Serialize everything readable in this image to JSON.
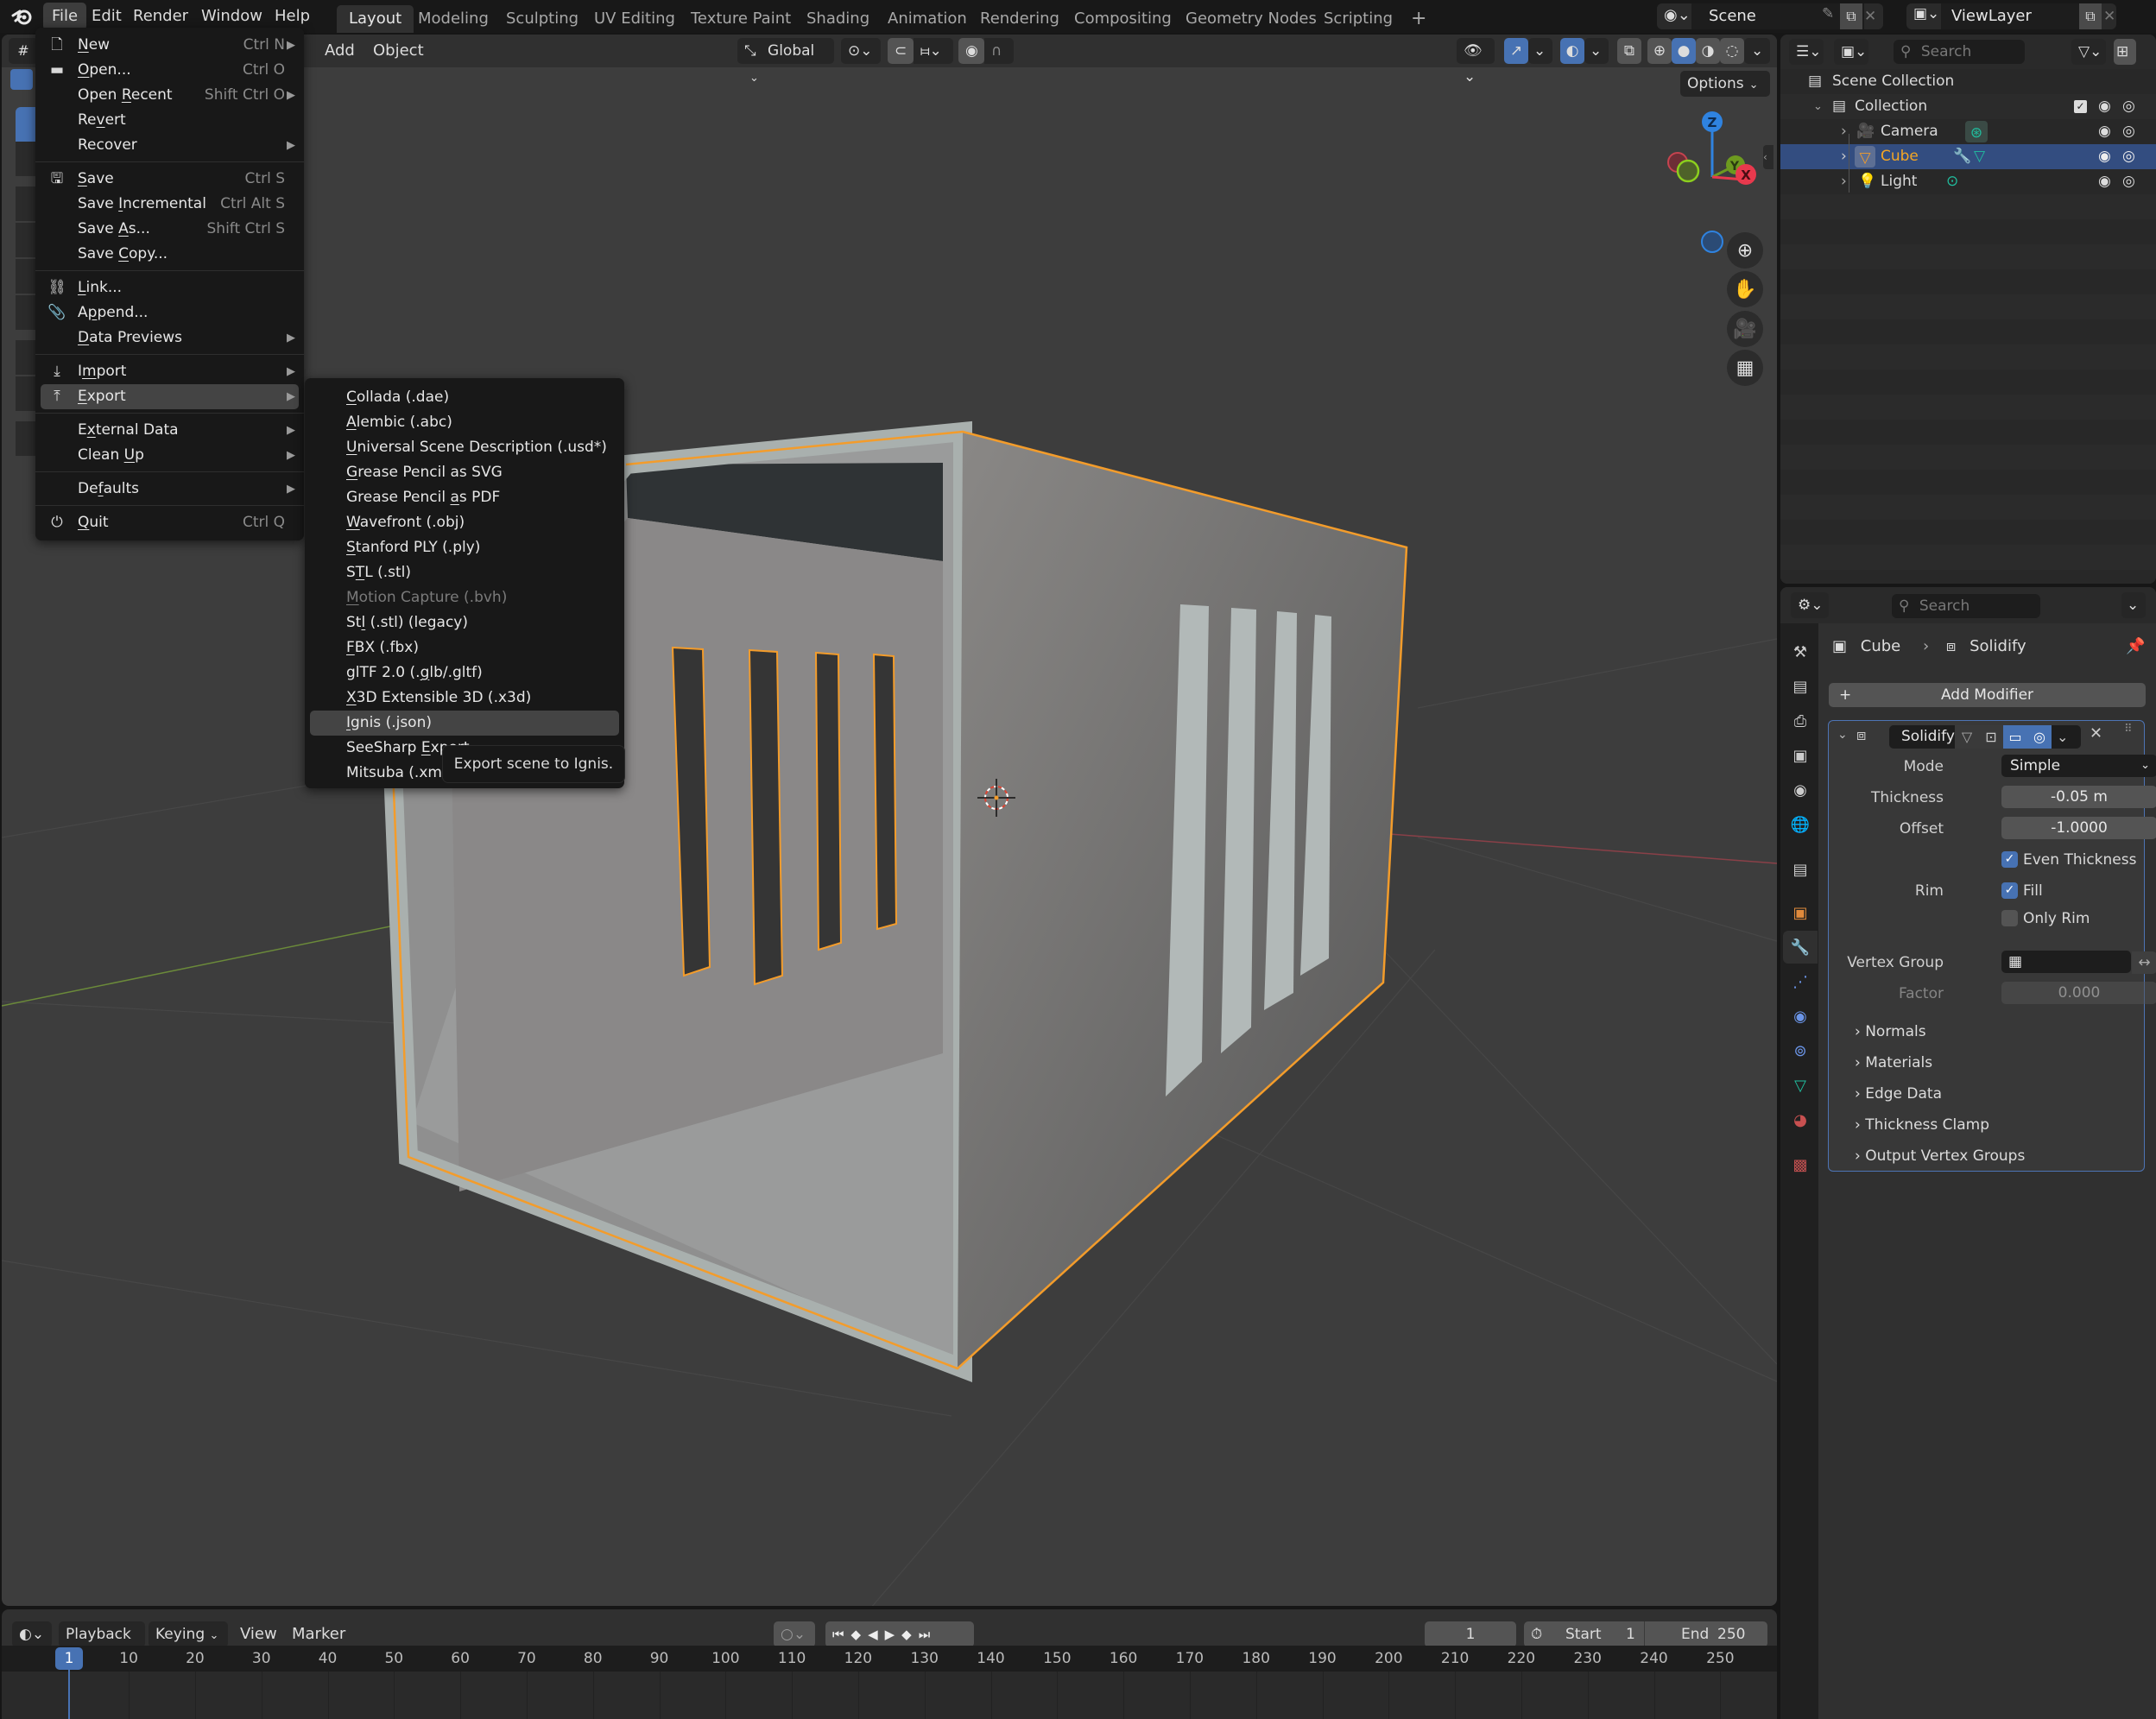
{
  "topbar": {
    "menus": [
      "File",
      "Edit",
      "Render",
      "Window",
      "Help"
    ],
    "workspaces": [
      "Layout",
      "Modeling",
      "Sculpting",
      "UV Editing",
      "Texture Paint",
      "Shading",
      "Animation",
      "Rendering",
      "Compositing",
      "Geometry Nodes",
      "Scripting"
    ],
    "active_workspace": "Layout",
    "add_workspace_icon": "+",
    "scene_name": "Scene",
    "view_layer_name": "ViewLayer"
  },
  "viewport": {
    "header_menus": [
      "Add",
      "Object"
    ],
    "transform_orientation": "Global",
    "options_label": "Options",
    "gizmo_axes": {
      "z": "Z",
      "y": "Y",
      "x": "X"
    },
    "colors": {
      "selection_outline": "#f39c2b",
      "x_axis": "#e8394d",
      "y_axis": "#6d9a1f",
      "z_axis": "#2f83e0",
      "background": "#3d3d3d"
    }
  },
  "file_menu": {
    "items": [
      {
        "label": "New",
        "underline": 0,
        "shortcut": "Ctrl N",
        "submenu": true,
        "icon": "new-file-icon"
      },
      {
        "label": "Open...",
        "underline": 0,
        "shortcut": "Ctrl O",
        "submenu": false,
        "icon": "folder-icon"
      },
      {
        "label": "Open Recent",
        "underline": 5,
        "shortcut": "Shift Ctrl O",
        "submenu": true
      },
      {
        "label": "Revert",
        "underline": 2,
        "shortcut": "",
        "submenu": false
      },
      {
        "label": "Recover",
        "underline": -1,
        "shortcut": "",
        "submenu": true
      },
      {
        "label": "Save",
        "underline": 0,
        "shortcut": "Ctrl S",
        "submenu": false,
        "icon": "save-icon"
      },
      {
        "label": "Save Incremental",
        "underline": 5,
        "shortcut": "Ctrl Alt S",
        "submenu": false
      },
      {
        "label": "Save As...",
        "underline": 5,
        "shortcut": "Shift Ctrl S",
        "submenu": false
      },
      {
        "label": "Save Copy...",
        "underline": 5,
        "shortcut": "",
        "submenu": false
      },
      {
        "label": "Link...",
        "underline": 0,
        "shortcut": "",
        "submenu": false,
        "icon": "link-icon"
      },
      {
        "label": "Append...",
        "underline": 1,
        "shortcut": "",
        "submenu": false,
        "icon": "paperclip-icon"
      },
      {
        "label": "Data Previews",
        "underline": 0,
        "shortcut": "",
        "submenu": true
      },
      {
        "label": "Import",
        "underline": 1,
        "shortcut": "",
        "submenu": true,
        "icon": "import-icon"
      },
      {
        "label": "Export",
        "underline": 0,
        "shortcut": "",
        "submenu": true,
        "icon": "export-icon",
        "highlighted": true
      },
      {
        "label": "External Data",
        "underline": 1,
        "shortcut": "",
        "submenu": true
      },
      {
        "label": "Clean Up",
        "underline": 6,
        "shortcut": "",
        "submenu": true
      },
      {
        "label": "Defaults",
        "underline": 2,
        "shortcut": "",
        "submenu": true
      },
      {
        "label": "Quit",
        "underline": 0,
        "shortcut": "Ctrl Q",
        "submenu": false,
        "icon": "power-icon"
      }
    ]
  },
  "export_menu": {
    "items": [
      {
        "label": "Collada (.dae)",
        "underline": 0
      },
      {
        "label": "Alembic (.abc)",
        "underline": 0
      },
      {
        "label": "Universal Scene Description (.usd*)",
        "underline": 0
      },
      {
        "label": "Grease Pencil as SVG",
        "underline": 0
      },
      {
        "label": "Grease Pencil as PDF",
        "underline": 14
      },
      {
        "label": "Wavefront (.obj)",
        "underline": 0
      },
      {
        "label": "Stanford PLY (.ply)",
        "underline": 0
      },
      {
        "label": "STL (.stl)",
        "underline": 1
      },
      {
        "label": "Motion Capture (.bvh)",
        "underline": 0,
        "disabled": true
      },
      {
        "label": "Stl (.stl) (legacy)",
        "underline": 2
      },
      {
        "label": "FBX (.fbx)",
        "underline": 0
      },
      {
        "label": "glTF 2.0 (.glb/.gltf)",
        "underline": 11
      },
      {
        "label": "X3D Extensible 3D (.x3d)",
        "underline": 0
      },
      {
        "label": "Ignis (.json)",
        "underline": 0,
        "highlighted": true
      },
      {
        "label": "SeeSharp Export",
        "underline": 9
      },
      {
        "label": "Mitsuba (.xml)",
        "underline": -1
      }
    ],
    "tooltip": "Export scene to Ignis."
  },
  "outliner": {
    "search_placeholder": "Search",
    "scene_collection": "Scene Collection",
    "collection": "Collection",
    "objects": [
      {
        "name": "Camera",
        "selected": false,
        "icon": "camera-icon",
        "data_icon": "camera-data-icon"
      },
      {
        "name": "Cube",
        "selected": true,
        "icon": "mesh-icon",
        "data_icon": "mesh-data-icon",
        "modifier_icon": "wrench-icon"
      },
      {
        "name": "Light",
        "selected": false,
        "icon": "light-icon",
        "data_icon": "light-data-icon"
      }
    ],
    "colors": {
      "selected_row": "#334d80",
      "selected_text": "#f5a623"
    }
  },
  "properties": {
    "search_placeholder": "Search",
    "breadcrumb": {
      "object": "Cube",
      "modifier": "Solidify"
    },
    "add_modifier_label": "Add Modifier",
    "modifier": {
      "name": "Solidify",
      "mode_label": "Mode",
      "mode_value": "Simple",
      "thickness_label": "Thickness",
      "thickness_value": "-0.05 m",
      "offset_label": "Offset",
      "offset_value": "-1.0000",
      "even_thickness_label": "Even Thickness",
      "even_thickness": true,
      "rim_label": "Rim",
      "fill_label": "Fill",
      "fill": true,
      "only_rim_label": "Only Rim",
      "only_rim": false,
      "vertex_group_label": "Vertex Group",
      "vertex_group_value": "",
      "factor_label": "Factor",
      "factor_value": "0.000"
    },
    "sections": [
      "Normals",
      "Materials",
      "Edge Data",
      "Thickness Clamp",
      "Output Vertex Groups"
    ]
  },
  "timeline": {
    "menus": [
      "Playback",
      "Keying",
      "View",
      "Marker"
    ],
    "current_frame": "1",
    "start_label": "Start",
    "start_value": "1",
    "end_label": "End",
    "end_value": "250",
    "ruler_ticks": [
      "10",
      "20",
      "30",
      "40",
      "50",
      "60",
      "70",
      "80",
      "90",
      "100",
      "110",
      "120",
      "130",
      "140",
      "150",
      "160",
      "170",
      "180",
      "190",
      "200",
      "210",
      "220",
      "230",
      "240",
      "250"
    ],
    "playhead_frame": "1"
  }
}
